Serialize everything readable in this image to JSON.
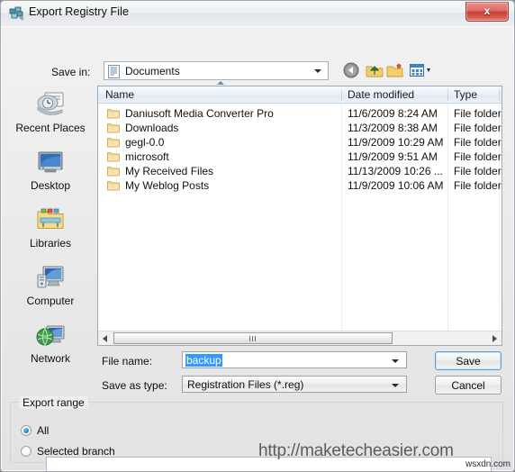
{
  "window": {
    "title": "Export Registry File",
    "title_icon": "registry-editor-icon",
    "close_label": "x"
  },
  "toolbar": {
    "save_in_label": "Save in:",
    "current_folder": "Documents",
    "folder_icon": "document-folder-icon",
    "buttons": [
      {
        "name": "back-button",
        "icon": "back-arrow-icon"
      },
      {
        "name": "up-one-level-button",
        "icon": "up-folder-icon"
      },
      {
        "name": "new-folder-button",
        "icon": "new-folder-icon"
      },
      {
        "name": "views-button",
        "icon": "views-grid-icon"
      }
    ]
  },
  "places": [
    {
      "label": "Recent Places",
      "icon": "recent-places-icon"
    },
    {
      "label": "Desktop",
      "icon": "desktop-icon"
    },
    {
      "label": "Libraries",
      "icon": "libraries-folder-icon"
    },
    {
      "label": "Computer",
      "icon": "computer-icon"
    },
    {
      "label": "Network",
      "icon": "network-globe-icon"
    }
  ],
  "file_list": {
    "columns": [
      "Name",
      "Date modified",
      "Type"
    ],
    "sort_column": "Name",
    "sort_direction": "ascending",
    "rows": [
      {
        "name": "Daniusoft Media Converter Pro",
        "date_modified": "11/6/2009 8:24 AM",
        "type": "File folder"
      },
      {
        "name": "Downloads",
        "date_modified": "11/3/2009 8:38 AM",
        "type": "File folder"
      },
      {
        "name": "gegl-0.0",
        "date_modified": "11/9/2009 10:29 AM",
        "type": "File folder"
      },
      {
        "name": "microsoft",
        "date_modified": "11/9/2009 9:51 AM",
        "type": "File folder"
      },
      {
        "name": "My Received Files",
        "date_modified": "11/13/2009 10:26 ...",
        "type": "File folder"
      },
      {
        "name": "My Weblog Posts",
        "date_modified": "11/9/2009 10:06 AM",
        "type": "File folder"
      }
    ]
  },
  "form": {
    "file_name_label": "File name:",
    "file_name_value": "backup",
    "save_as_type_label": "Save as type:",
    "save_as_type_value": "Registration Files (*.reg)",
    "save_label": "Save",
    "cancel_label": "Cancel"
  },
  "export_range": {
    "group_title": "Export range",
    "options": [
      {
        "label": "All",
        "selected": true
      },
      {
        "label": "Selected branch",
        "selected": false
      }
    ],
    "branch_value": ""
  },
  "watermarks": {
    "main": "http://maketecheasier.com",
    "corner": "wsxdn.com"
  },
  "colors": {
    "accent": "#3399ff",
    "close_red": "#c93f33",
    "dialog_bg": "#eeeeee",
    "default_button_border": "#4f9fd0"
  }
}
